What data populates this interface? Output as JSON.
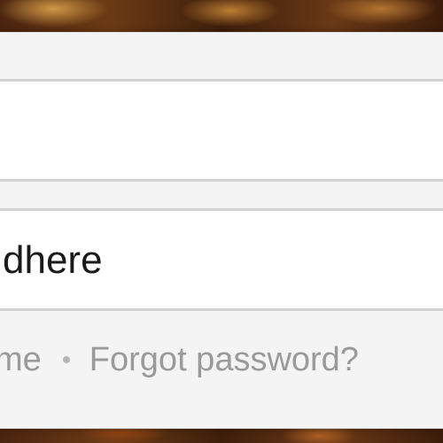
{
  "login_form": {
    "username_value": "",
    "password_value": "dhere",
    "remember_link": "me",
    "forgot_link": "Forgot password?"
  },
  "icons": {
    "separator": "bullet-separator-icon"
  },
  "colors": {
    "card_background": "#f4f4f4",
    "field_border": "#d3d3d3",
    "link_text": "#9a9a9a",
    "input_text": "#1a1a1a"
  }
}
